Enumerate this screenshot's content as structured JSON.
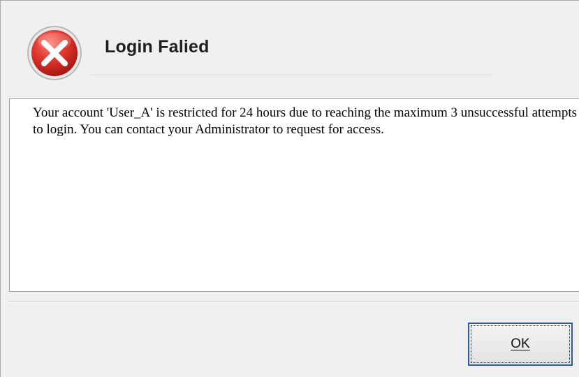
{
  "dialog": {
    "title": "Login Falied",
    "icon": "error-icon",
    "accent_color": "#d9302c",
    "message": "Your account 'User_A' is restricted for 24 hours due to reaching the maximum 3 unsuccessful attempts to login. You can contact your Administrator to request for access.",
    "buttons": {
      "ok_label": "OK"
    }
  }
}
